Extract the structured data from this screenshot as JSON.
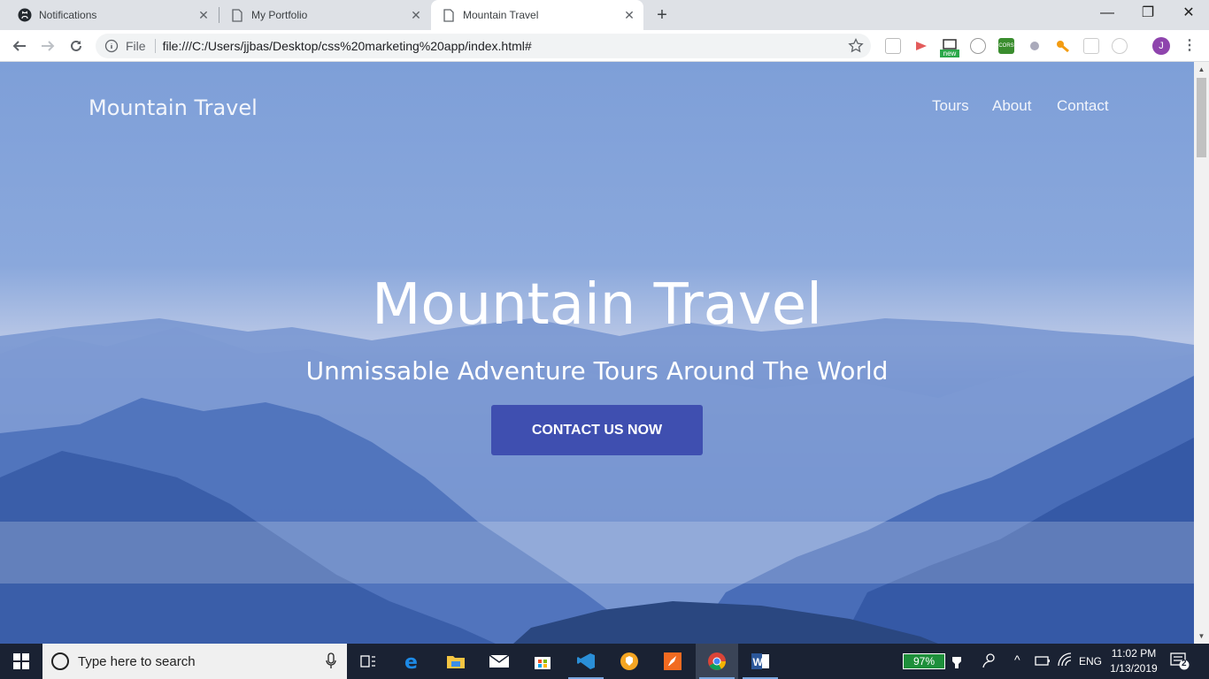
{
  "browser": {
    "tabs": [
      {
        "label": "Notifications",
        "icon": "github-icon"
      },
      {
        "label": "My Portfolio",
        "icon": "page-icon"
      },
      {
        "label": "Mountain Travel",
        "icon": "page-icon",
        "active": true
      }
    ],
    "address": {
      "scheme_label": "File",
      "url": "file:///C:/Users/jjbas/Desktop/css%20marketing%20app/index.html#"
    },
    "profile_initial": "J",
    "extensions": [
      "pocket-icon",
      "readmore-icon",
      "new-badge-icon",
      "onetab-icon",
      "cors-icon",
      "puzzle-icon",
      "key-icon",
      "qr-icon",
      "ghost-icon"
    ],
    "new_badge": "new",
    "cors_label": "CORS"
  },
  "site": {
    "brand": "Mountain Travel",
    "nav": [
      "Tours",
      "About",
      "Contact"
    ],
    "hero_title": "Mountain Travel",
    "hero_subtitle": "Unmissable Adventure Tours Around The World",
    "cta_label": "CONTACT US NOW"
  },
  "taskbar": {
    "search_placeholder": "Type here to search",
    "battery": "97%",
    "language": "ENG",
    "time": "11:02 PM",
    "date": "1/13/2019",
    "notifications": "2"
  },
  "colors": {
    "cta": "#3f4fb0",
    "tab_strip": "#dee1e6",
    "taskbar": "#1a2233"
  }
}
